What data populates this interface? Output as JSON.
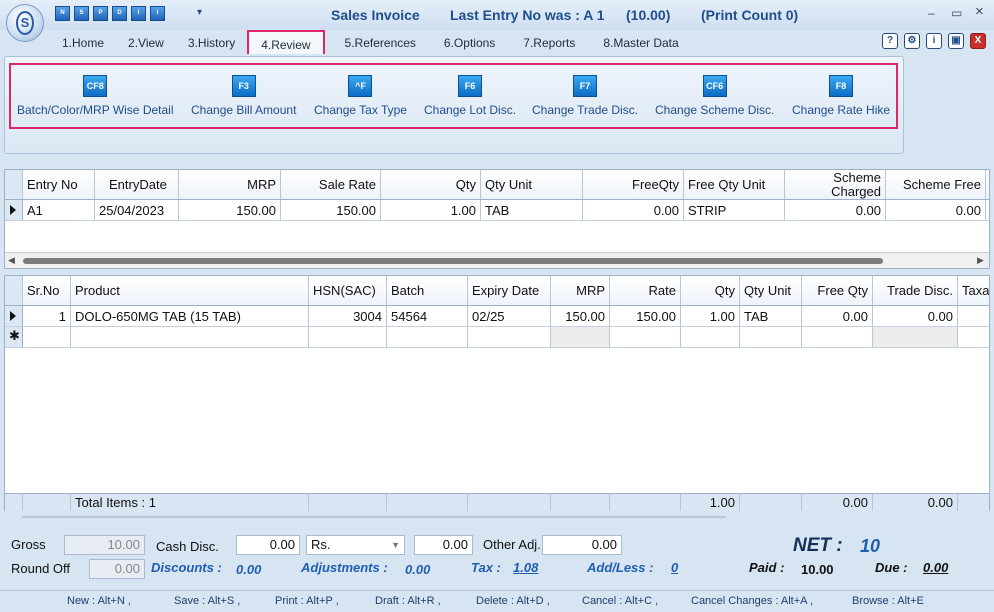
{
  "window": {
    "title": "Sales Invoice",
    "last_entry": "Last Entry No was : A 1",
    "amount": "(10.00)",
    "print_count": "(Print Count 0)",
    "app_badge": "S",
    "minimize": "–",
    "maximize": "▭",
    "close": "×"
  },
  "qat": [
    "N",
    "S",
    "P",
    "D",
    "I",
    "I"
  ],
  "qat_more": "▾",
  "tabs": [
    "1.Home",
    "2.View",
    "3.History",
    "4.Review",
    "5.References",
    "6.Options",
    "7.Reports",
    "8.Master Data"
  ],
  "help_icons": [
    "?",
    "⚙",
    "i",
    "▣",
    "X"
  ],
  "ribbon": {
    "buttons": [
      {
        "key": "CF8",
        "label": "Batch/Color/MRP Wise Detail"
      },
      {
        "key": "F3",
        "label": "Change Bill Amount"
      },
      {
        "key": "^F",
        "label": "Change Tax Type"
      },
      {
        "key": "F6",
        "label": "Change Lot Disc."
      },
      {
        "key": "F7",
        "label": "Change Trade Disc."
      },
      {
        "key": "CF6",
        "label": "Change Scheme Disc."
      },
      {
        "key": "F8",
        "label": "Change Rate Hike"
      }
    ]
  },
  "entries_grid": {
    "headers": [
      "Entry No",
      "EntryDate",
      "MRP",
      "Sale Rate",
      "Qty",
      "Qty Unit",
      "FreeQty",
      "Free Qty Unit",
      "Scheme Charged",
      "Scheme Free"
    ],
    "rows": [
      [
        "A1",
        "25/04/2023",
        "150.00",
        "150.00",
        "1.00",
        "TAB",
        "0.00",
        "STRIP",
        "0.00",
        "0.00"
      ]
    ]
  },
  "items_grid": {
    "headers": [
      "Sr.No",
      "Product",
      "HSN(SAC)",
      "Batch",
      "Expiry Date",
      "MRP",
      "Rate",
      "Qty",
      "Qty Unit",
      "Free Qty",
      "Trade Disc.",
      "Taxa"
    ],
    "rows": [
      [
        "1",
        "DOLO-650MG TAB (15 TAB)",
        "3004",
        "54564",
        "02/25",
        "150.00",
        "150.00",
        "1.00",
        "TAB",
        "0.00",
        "0.00",
        ""
      ]
    ],
    "totals": {
      "label": "Total Items : 1",
      "qty": "1.00",
      "free_qty": "0.00",
      "trade_disc": "0.00"
    }
  },
  "footer": {
    "gross_label": "Gross",
    "gross": "10.00",
    "cash_disc_label": "Cash Disc.",
    "cash_disc": "0.00",
    "currency": "Rs.",
    "cash_disc_amt": "0.00",
    "other_adj_label": "Other Adj.",
    "other_adj": "0.00",
    "round_off_label": "Round Off",
    "round_off": "0.00",
    "discounts_label": "Discounts :",
    "discounts": "0.00",
    "adjustments_label": "Adjustments :",
    "adjustments": "0.00",
    "tax_label": "Tax :",
    "tax": "1.08",
    "addless_label": "Add/Less :",
    "addless": "0",
    "net_label": "NET :",
    "net": "10",
    "paid_label": "Paid :",
    "paid": "10.00",
    "due_label": "Due :",
    "due": "0.00"
  },
  "shortcuts": [
    "New : Alt+N ,",
    "Save : Alt+S ,",
    "Print : Alt+P ,",
    "Draft : Alt+R ,",
    "Delete : Alt+D ,",
    "Cancel : Alt+C ,",
    "Cancel Changes : Alt+A ,",
    "Browse : Alt+E"
  ],
  "colors": {
    "accent": "#e0266a",
    "brand": "#1f5fb0"
  }
}
